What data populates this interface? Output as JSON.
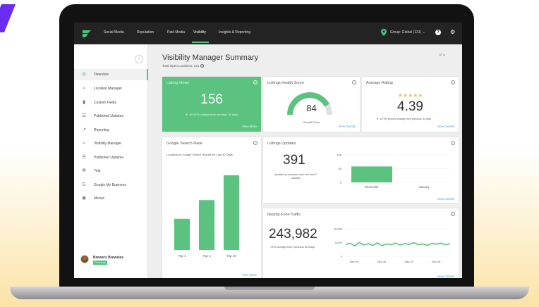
{
  "topbar": {
    "nav": [
      "Social Media",
      "Reputation",
      "Paid Media",
      "Visibility",
      "Insights & Reporting"
    ],
    "active_nav": "Visibility",
    "group_label": "Group: Global (131) ⌄"
  },
  "sidebar": {
    "items": [
      {
        "label": "Overview",
        "icon": "circle-icon",
        "glyph": "◎"
      },
      {
        "label": "Location Manager",
        "icon": "search-location-icon",
        "glyph": "⌕"
      },
      {
        "label": "Custom Fields",
        "icon": "fields-icon",
        "glyph": "▮"
      },
      {
        "label": "Published Updates",
        "icon": "list-icon",
        "glyph": "☰"
      },
      {
        "label": "Reporting",
        "icon": "chart-line-icon",
        "glyph": "↗"
      },
      {
        "label": "Visibility Manager",
        "icon": "search-icon",
        "glyph": "⌕"
      },
      {
        "label": "Published Updates",
        "icon": "list-icon",
        "glyph": "☰"
      },
      {
        "label": "Yelp",
        "icon": "yelp-icon",
        "glyph": "✻"
      },
      {
        "label": "Google My Business",
        "icon": "google-icon",
        "glyph": "G"
      },
      {
        "label": "Menus",
        "icon": "menu-icon",
        "glyph": "◉"
      }
    ],
    "account": {
      "name": "Brewers Brewsies",
      "badge": "Premium"
    }
  },
  "page": {
    "title": "Visibility Manager Summary",
    "subtitle": "Total Open Locations: 121"
  },
  "listing_views": {
    "title": "Listing Views",
    "value": "156",
    "change": "▼ -30.67% change from previous 30 days",
    "link": "View More"
  },
  "health": {
    "title": "Listings Health Score",
    "value": "84",
    "label": "Overall Score",
    "link": "View Details",
    "score_fraction": 0.84
  },
  "rating": {
    "title": "Average Rating",
    "stars": "★★★★✬",
    "value": "4.39",
    "change": "▼ -8.79% percent change from previous 30 days",
    "link": "View Details"
  },
  "search_rank": {
    "title": "Google Search Rank",
    "subtitle": "Locations in Google Search Results for Last 30 Days",
    "link": "View More"
  },
  "updates": {
    "title": "Listings Updates",
    "value": "391",
    "note": "updates processed over the last 2 months",
    "link": "View Details"
  },
  "foot_traffic": {
    "title": "Nearby Foot-Traffic",
    "value": "243,982",
    "note": "72% change from previous 30 days",
    "link": "View Details"
  },
  "colors": {
    "accent": "#5bc27f",
    "topbar": "#232323",
    "link": "#4fa7d8",
    "purple": "#6a2cf0"
  },
  "chart_data": [
    {
      "type": "bar",
      "title": "Google Search Rank",
      "categories": [
        "Top 1",
        "Top 3",
        "Top 10"
      ],
      "values": [
        25,
        40,
        60
      ],
      "ylim": [
        0,
        65
      ]
    },
    {
      "type": "bar",
      "title": "Listings Updates",
      "categories": [
        "December",
        "January"
      ],
      "values": [
        58,
        0
      ],
      "yticks": [
        "100",
        "50",
        "0"
      ],
      "ylim": [
        0,
        100
      ]
    },
    {
      "type": "line",
      "title": "Nearby Foot-Traffic",
      "x": [
        "Dec 00",
        "Dec 16",
        "Dec 22",
        "Dec 30"
      ],
      "yticks": [
        "10,000",
        "5,000",
        "0"
      ],
      "ylim": [
        0,
        10000
      ],
      "values": [
        4300,
        4700,
        3800,
        5000,
        4100,
        4600,
        4000,
        4900,
        3900,
        4500,
        4200,
        4800,
        4100,
        4600,
        4300,
        5000,
        4200,
        4500,
        4000,
        4700,
        4400,
        4800,
        4200,
        4600
      ]
    }
  ]
}
